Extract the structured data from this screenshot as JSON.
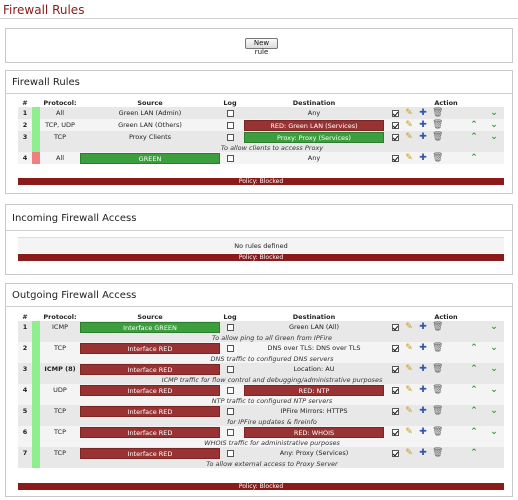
{
  "page": {
    "title": "Firewall Rules"
  },
  "toolbar": {
    "new_rule_label": "New rule"
  },
  "columns": {
    "num": "#",
    "protocol": "Protocol:",
    "source": "Source",
    "log": "Log",
    "destination": "Destination",
    "action": "Action"
  },
  "firewall_rules": {
    "title": "Firewall Rules",
    "policy": "Policy: Blocked",
    "rows": [
      {
        "num": "1",
        "status": "enabled",
        "protocol": "All",
        "source": "Green LAN (Admin)",
        "source_style": "plain",
        "log": false,
        "destination": "Any",
        "dest_style": "plain",
        "enabled": true,
        "remark": "",
        "up": false,
        "down": true
      },
      {
        "num": "2",
        "status": "enabled",
        "protocol": "TCP, UDP",
        "source": "Green LAN (Others)",
        "source_style": "plain",
        "log": false,
        "destination": "RED: Green LAN (Services)",
        "dest_style": "red",
        "enabled": true,
        "remark": "",
        "up": true,
        "down": true
      },
      {
        "num": "3",
        "status": "enabled",
        "protocol": "TCP",
        "source": "Proxy Clients",
        "source_style": "plain",
        "log": false,
        "destination": "Proxy: Proxy (Services)",
        "dest_style": "green",
        "enabled": true,
        "remark": "To allow clients to access Proxy",
        "up": true,
        "down": true
      },
      {
        "num": "4",
        "status": "disabled",
        "protocol": "All",
        "source": "GREEN",
        "source_style": "green",
        "log": false,
        "destination": "Any",
        "dest_style": "plain",
        "enabled": true,
        "remark": "",
        "up": true,
        "down": false
      }
    ]
  },
  "incoming": {
    "title": "Incoming Firewall Access",
    "empty_text": "No rules defined",
    "policy": "Policy: Blocked"
  },
  "outgoing": {
    "title": "Outgoing Firewall Access",
    "policy": "Policy: Blocked",
    "rows": [
      {
        "num": "1",
        "status": "enabled",
        "protocol": "ICMP",
        "protocol_bold": false,
        "source": "Interface GREEN",
        "source_style": "green",
        "log": false,
        "destination": "Green LAN (All)",
        "dest_style": "plain",
        "enabled": true,
        "remark": "To allow ping to all Green from IPFire",
        "up": false,
        "down": true
      },
      {
        "num": "2",
        "status": "enabled",
        "protocol": "TCP",
        "protocol_bold": false,
        "source": "Interface RED",
        "source_style": "red",
        "log": false,
        "destination": "DNS over TLS: DNS over TLS",
        "dest_style": "plain",
        "enabled": true,
        "remark": "DNS traffic to configured DNS servers",
        "up": true,
        "down": true
      },
      {
        "num": "3",
        "status": "enabled",
        "protocol": "ICMP (8)",
        "protocol_bold": true,
        "source": "Interface RED",
        "source_style": "red",
        "log": false,
        "destination": "Location: AU",
        "dest_style": "plain",
        "enabled": true,
        "remark": "ICMP traffic for flow control and debugging/administrative purposes",
        "up": true,
        "down": true
      },
      {
        "num": "4",
        "status": "enabled",
        "protocol": "UDP",
        "protocol_bold": false,
        "source": "Interface RED",
        "source_style": "red",
        "log": false,
        "destination": "RED: NTP",
        "dest_style": "red",
        "enabled": true,
        "remark": "NTP traffic to configured NTP servers",
        "up": true,
        "down": true
      },
      {
        "num": "5",
        "status": "enabled",
        "protocol": "TCP",
        "protocol_bold": false,
        "source": "Interface RED",
        "source_style": "red",
        "log": false,
        "destination": "IPFire Mirrors: HTTPS",
        "dest_style": "plain",
        "enabled": true,
        "remark": "for IPFire updates & fireinfo",
        "up": true,
        "down": true
      },
      {
        "num": "6",
        "status": "enabled",
        "protocol": "TCP",
        "protocol_bold": false,
        "source": "Interface RED",
        "source_style": "red",
        "log": false,
        "destination": "RED: WHOIS",
        "dest_style": "red",
        "enabled": true,
        "remark": "WHOIS traffic for administrative purposes",
        "up": true,
        "down": true
      },
      {
        "num": "7",
        "status": "enabled",
        "protocol": "TCP",
        "protocol_bold": false,
        "source": "Interface RED",
        "source_style": "red",
        "log": false,
        "destination": "Any: Proxy (Services)",
        "dest_style": "plain",
        "enabled": true,
        "remark": "To allow external access to Proxy Server",
        "up": true,
        "down": false
      }
    ]
  },
  "colors": {
    "title": "#8b1a1a",
    "policy_bar": "#8b1a1a",
    "green_cell": "#3d9e3d",
    "red_cell": "#993333",
    "status_ok": "#90ee90",
    "status_bad": "#f08080"
  },
  "icons": {
    "edit": "pencil-icon",
    "copy": "copy-plus-icon",
    "delete": "trash-icon",
    "up": "chevron-up-icon",
    "down": "chevron-down-icon"
  }
}
